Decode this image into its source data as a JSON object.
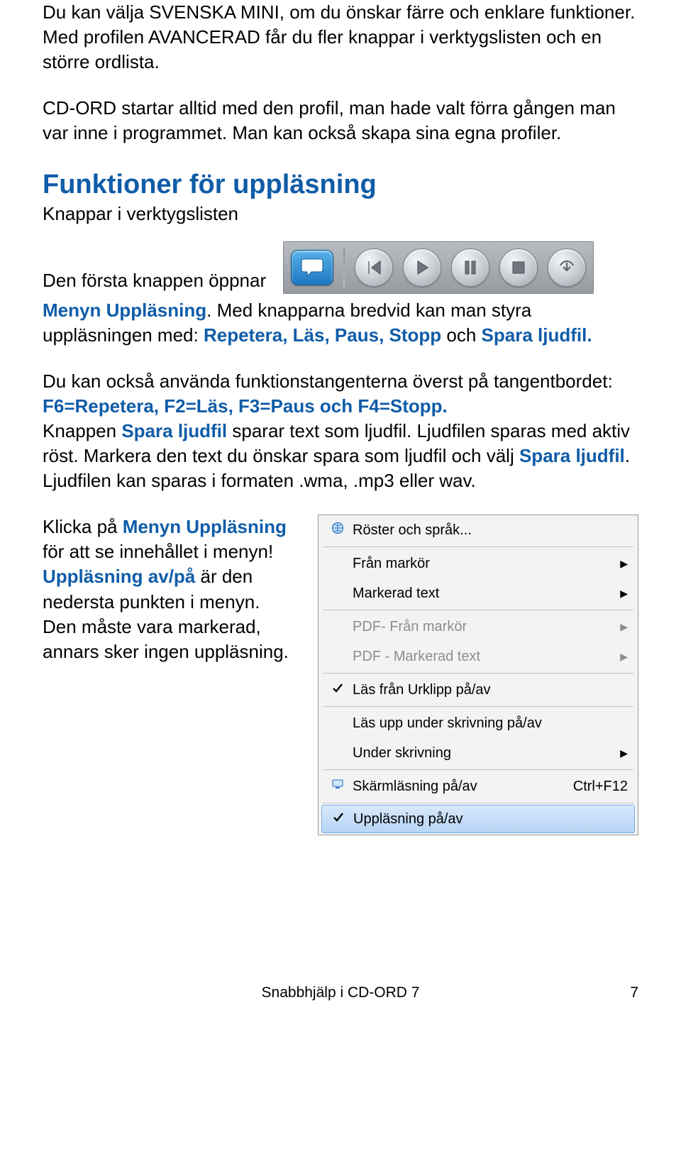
{
  "intro": {
    "p1_a": "Du kan välja SVENSKA MINI, om du önskar färre och enklare funktioner. Med profilen AVANCERAD får du fler knappar i verktygslisten och en större ordlista.",
    "p1_b": "CD-ORD startar alltid med den profil, man hade valt förra gången man var inne i programmet. Man kan också skapa sina egna profiler."
  },
  "section": {
    "title": "Funktioner för uppläsning",
    "subhead": "Knappar i verktygslisten",
    "caption": "Den första knappen öppnar",
    "p2_lead": "Menyn Uppläsning",
    "p2_rest": ". Med knapparna bredvid kan man styra uppläsningen med: ",
    "p2_cmds": "Repetera, Läs, Paus, Stopp",
    "p2_and": " och ",
    "p2_last": "Spara ljudfil.",
    "p3_a": "Du kan också använda funktionstangenterna överst på tangentbordet:",
    "p3_keys": "F6=Repetera, F2=Läs, F3=Paus och F4=Stopp.",
    "p4_a": "Knappen ",
    "p4_btn": "Spara ljudfil",
    "p4_b": " sparar text som ljudfil. Ljudfilen sparas med aktiv röst. Markera den text du önskar spara som ljudfil och välj ",
    "p4_btn2": "Spara ljudfil",
    "p4_c": ". Ljudfilen kan sparas i formaten .wma, .mp3 eller wav.",
    "left_a": "Klicka på ",
    "left_menu": "Menyn Uppläsning",
    "left_b": " för att se innehållet i menyn!",
    "left_toggle": "Uppläsning av/på",
    "left_c": " är den nedersta punkten i menyn. Den måste vara markerad, annars sker ingen uppläsning."
  },
  "menu": {
    "items": [
      {
        "icon": "globe",
        "label": "Röster och språk..."
      },
      {
        "sep": true
      },
      {
        "label": "Från markör",
        "arrow": true
      },
      {
        "label": "Markerad text",
        "arrow": true
      },
      {
        "sep": true
      },
      {
        "label": "PDF- Från markör",
        "arrow": true,
        "disabled": true
      },
      {
        "label": "PDF - Markerad text",
        "arrow": true,
        "disabled": true
      },
      {
        "sep": true
      },
      {
        "icon": "check",
        "label": "Läs från Urklipp på/av"
      },
      {
        "sep": true
      },
      {
        "label": "Läs upp under skrivning på/av"
      },
      {
        "label": "Under skrivning",
        "arrow": true
      },
      {
        "sep": true
      },
      {
        "icon": "monitor",
        "label": "Skärmläsning på/av",
        "shortcut": "Ctrl+F12"
      },
      {
        "sep": true
      },
      {
        "icon": "check",
        "label": "Uppläsning på/av",
        "selected": true
      }
    ]
  },
  "footer": {
    "title": "Snabbhjälp i CD-ORD 7",
    "page": "7"
  },
  "toolbar_buttons": [
    "speech-menu",
    "repeat",
    "play",
    "pause",
    "stop",
    "save-audio"
  ]
}
